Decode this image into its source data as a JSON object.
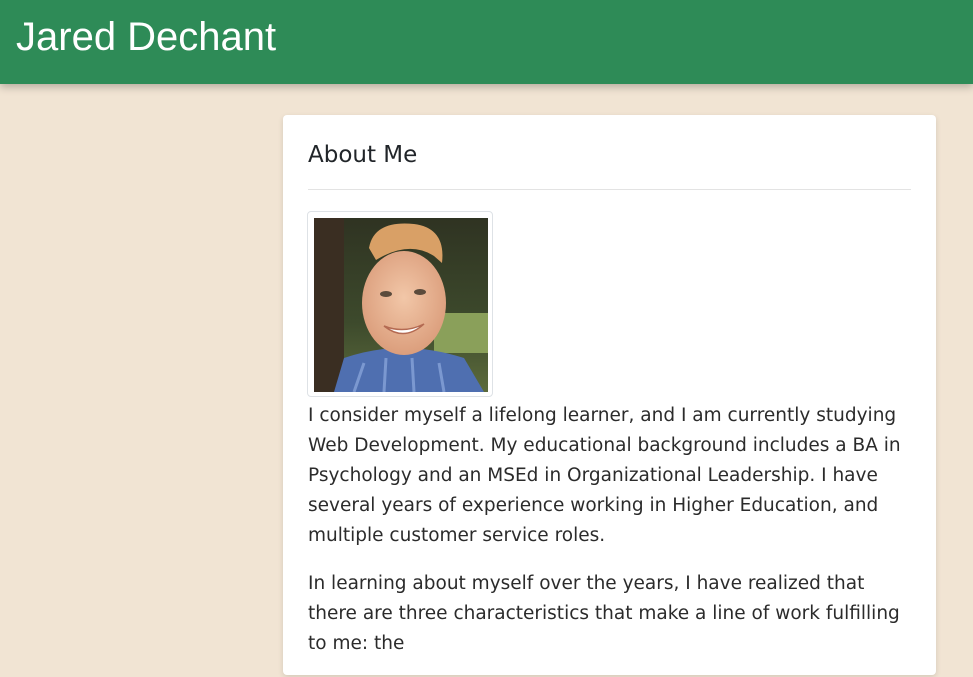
{
  "header": {
    "title": "Jared Dechant"
  },
  "about": {
    "heading": "About Me",
    "photo_alt": "Photo of Jared Dechant",
    "paragraphs": [
      "I consider myself a lifelong learner, and I am currently studying Web Development. My educational background includes a BA in Psychology and an MSEd in Organizational Leadership. I have several years of experience working in Higher Education, and multiple customer service roles.",
      "In learning about myself over the years, I have realized that there are three characteristics that make a line of work fulfilling to me: the"
    ]
  },
  "colors": {
    "header_bg": "#2e8b57",
    "page_bg": "#f1e4d3",
    "card_bg": "#ffffff"
  }
}
